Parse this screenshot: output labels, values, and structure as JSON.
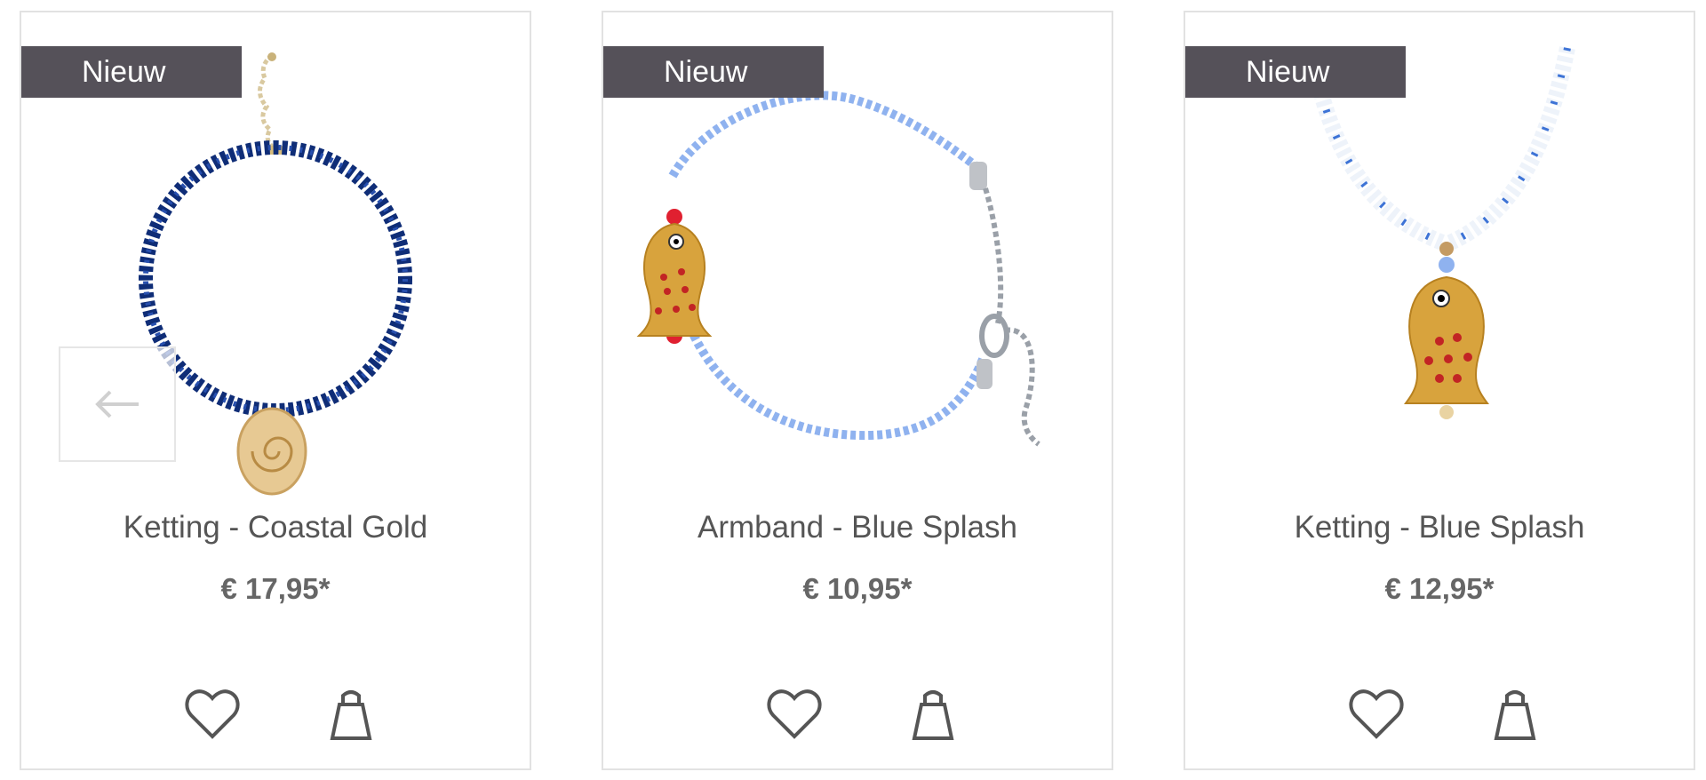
{
  "products": [
    {
      "badge": "Nieuw",
      "title": "Ketting - Coastal Gold",
      "price": "€ 17,95*"
    },
    {
      "badge": "Nieuw",
      "title": "Armband - Blue Splash",
      "price": "€ 10,95*"
    },
    {
      "badge": "Nieuw",
      "title": "Ketting - Blue Splash",
      "price": "€ 12,95*"
    }
  ],
  "icons": {
    "wishlist": "heart-icon",
    "cart": "shopping-bag-icon",
    "prev": "arrow-left-icon"
  },
  "colors": {
    "badge_bg": "#555159",
    "text": "#555555",
    "border": "#e2e2e2"
  }
}
